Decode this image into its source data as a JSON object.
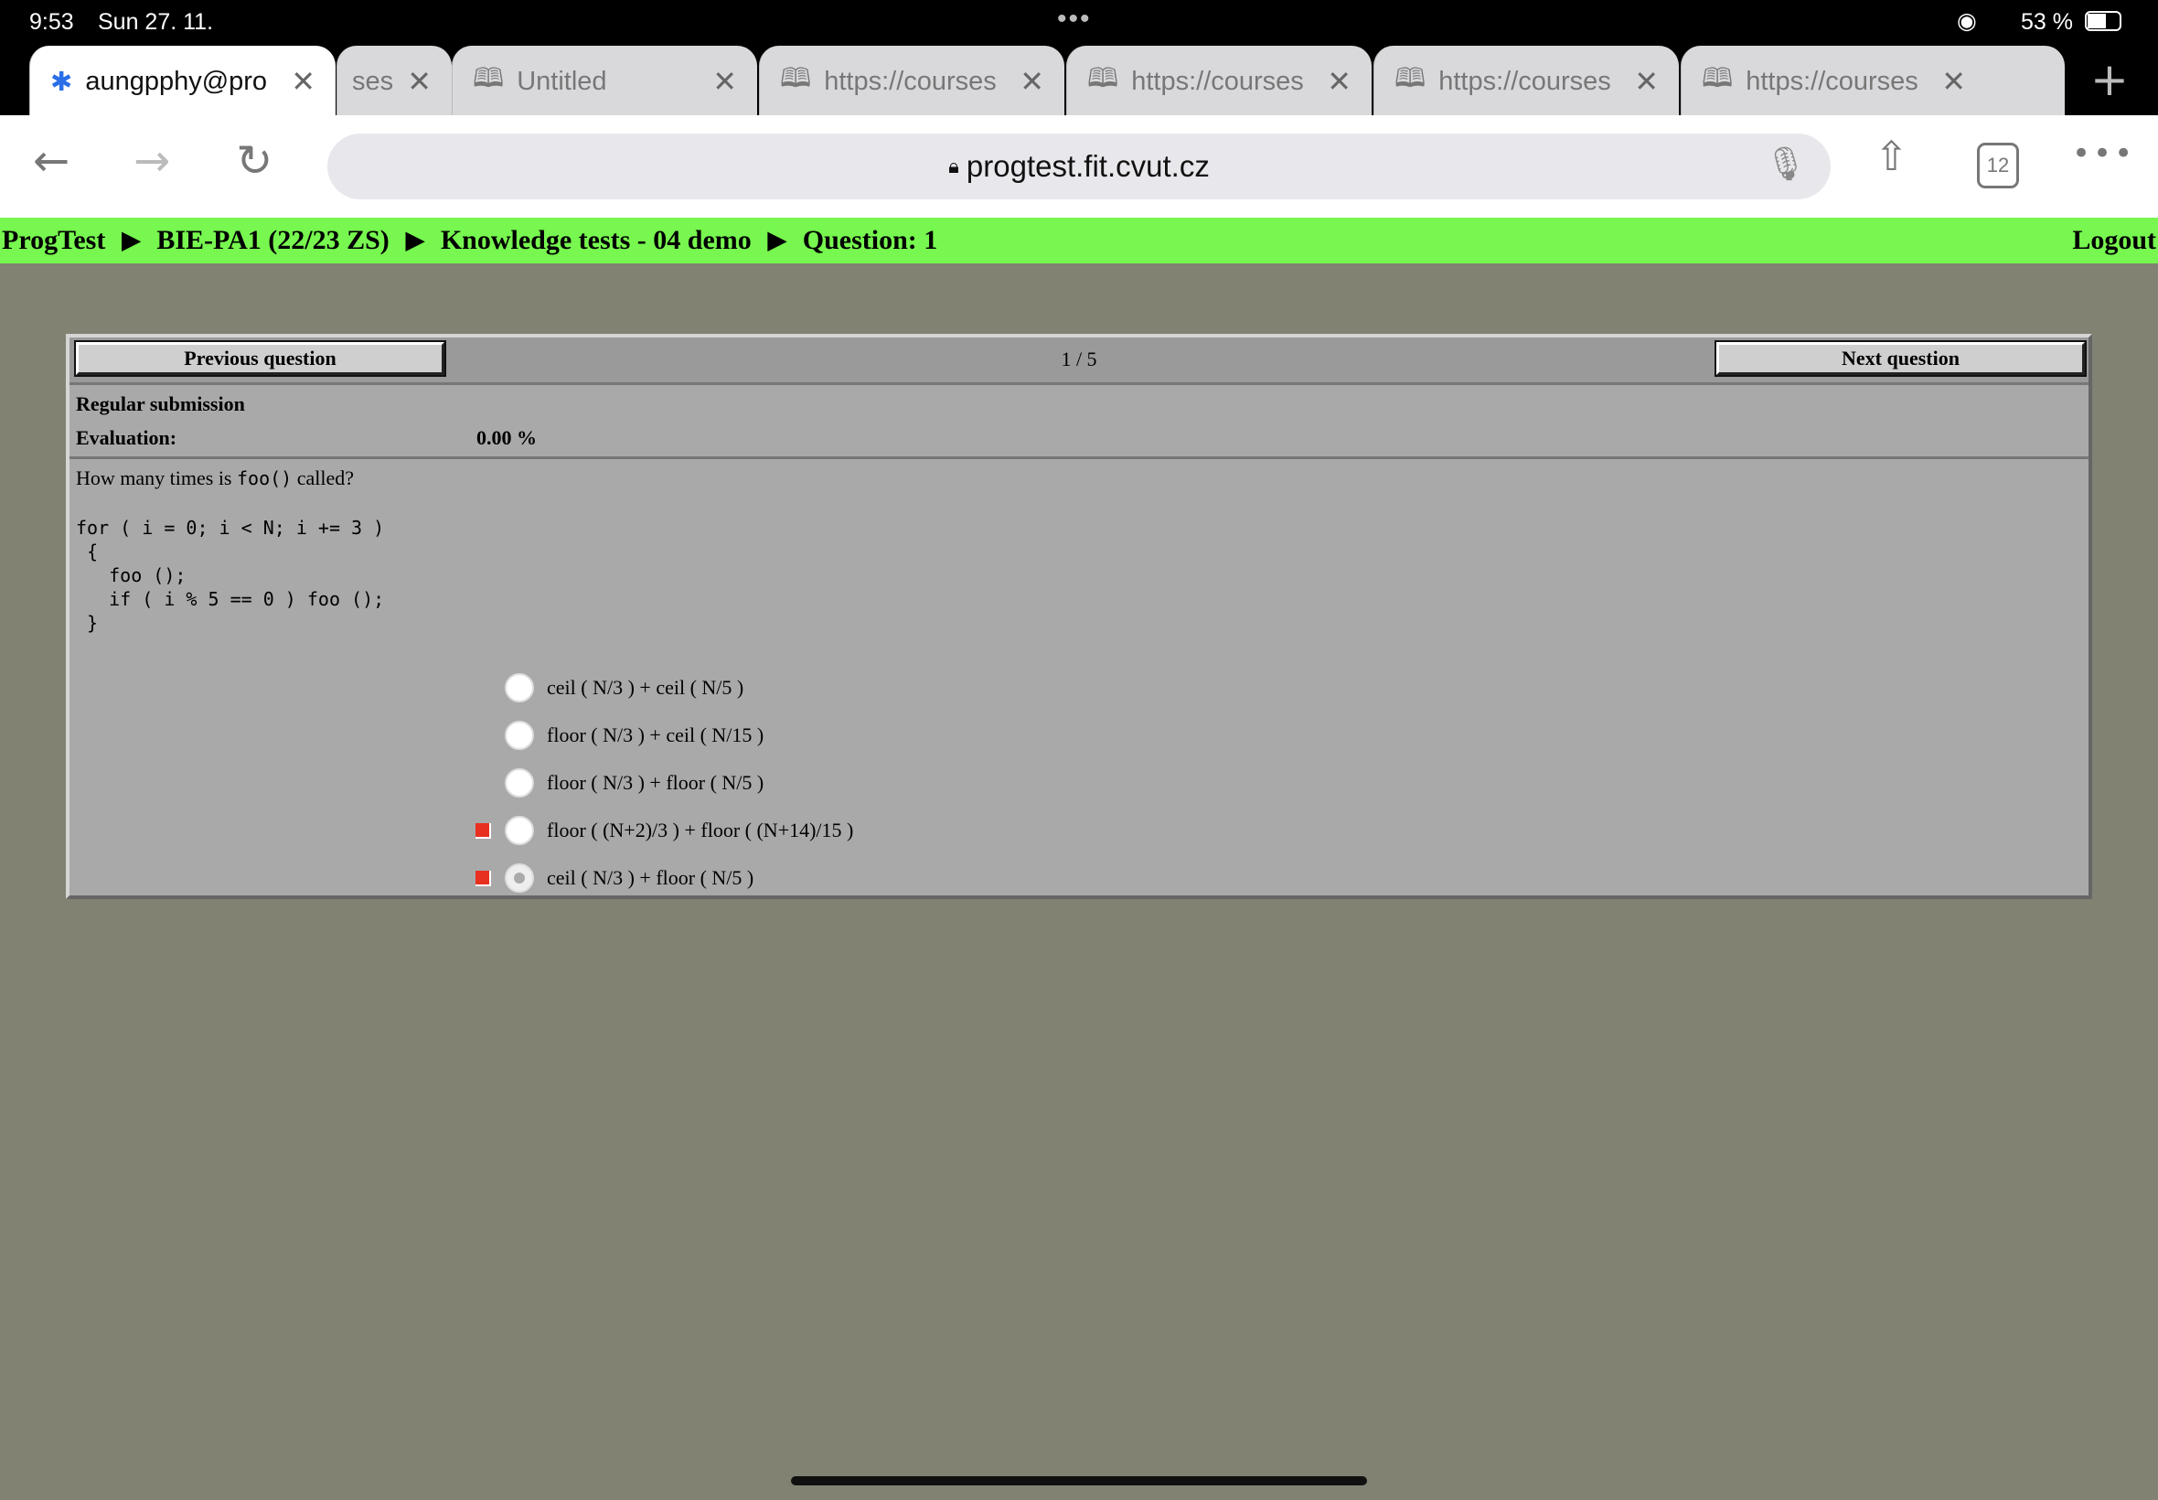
{
  "status_bar": {
    "time": "9:53",
    "date": "Sun 27. 11.",
    "battery": "53 %"
  },
  "tabs": [
    {
      "label": "aungpphy@pro",
      "active": true
    },
    {
      "label": "ses"
    },
    {
      "label": "Untitled"
    },
    {
      "label": "https://courses"
    },
    {
      "label": "https://courses"
    },
    {
      "label": "https://courses"
    },
    {
      "label": "https://courses"
    }
  ],
  "toolbar": {
    "url": "progtest.fit.cvut.cz",
    "tab_count": "12"
  },
  "breadcrumb": {
    "items": [
      "ProgTest",
      "BIE-PA1 (22/23 ZS)",
      "Knowledge tests - 04 demo",
      "Question: 1"
    ],
    "logout": "Logout"
  },
  "quiz": {
    "prev": "Previous question",
    "next": "Next question",
    "pager": "1 / 5",
    "submission": "Regular submission",
    "eval_label": "Evaluation:",
    "eval_value": "0.00 %",
    "question_pre": "How many times is ",
    "question_code": "foo()",
    "question_post": " called?",
    "code": "for ( i = 0; i < N; i += 3 )\n {\n   foo ();\n   if ( i % 5 == 0 ) foo ();\n }",
    "options": [
      {
        "label": "ceil ( N/3 ) + ceil ( N/5 )",
        "marked": false,
        "checked": false
      },
      {
        "label": "floor ( N/3 ) + ceil ( N/15 )",
        "marked": false,
        "checked": false
      },
      {
        "label": "floor ( N/3 ) + floor ( N/5 )",
        "marked": false,
        "checked": false
      },
      {
        "label": "floor ( (N+2)/3 ) + floor ( (N+14)/15 )",
        "marked": true,
        "checked": false
      },
      {
        "label": "ceil ( N/3 ) + floor ( N/5 )",
        "marked": true,
        "checked": true
      }
    ]
  },
  "colors": {
    "green": "#77f74f",
    "bg": "#818272",
    "wrong": "#e83020"
  }
}
